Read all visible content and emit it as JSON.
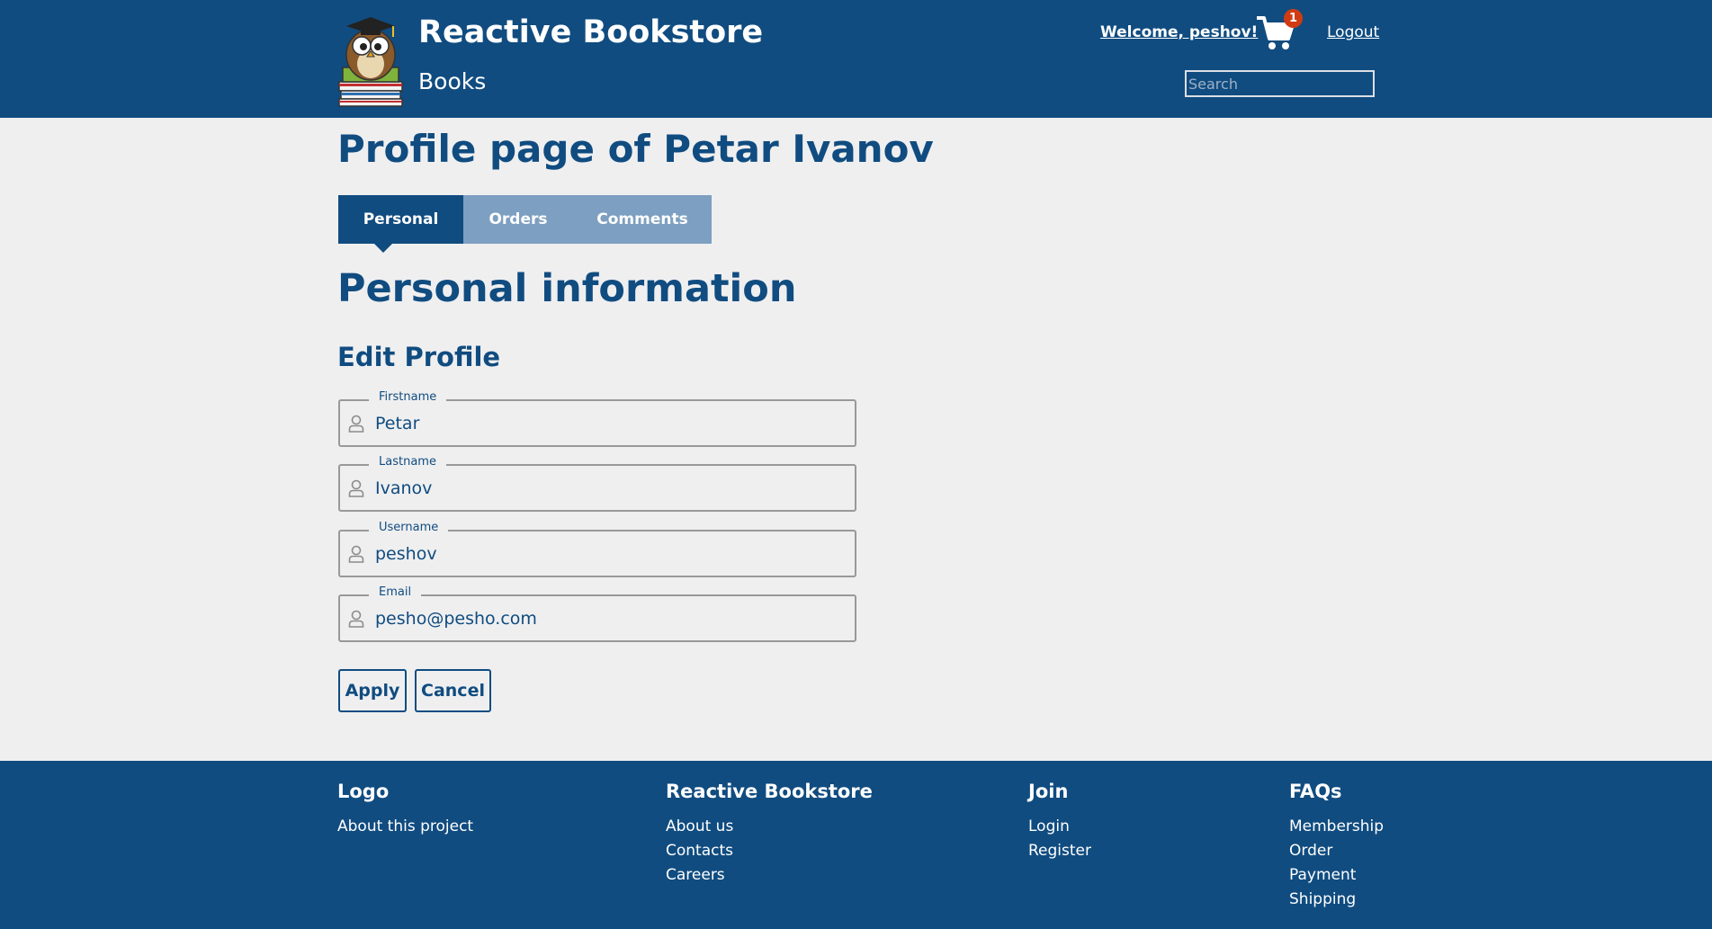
{
  "header": {
    "title": "Reactive Bookstore",
    "subtitle": "Books",
    "welcome": "Welcome, peshov!",
    "cart_count": "1",
    "logout": "Logout",
    "search_placeholder": "Search"
  },
  "page": {
    "title": "Profile page of Petar Ivanov",
    "tabs": [
      {
        "label": "Personal",
        "active": true
      },
      {
        "label": "Orders",
        "active": false
      },
      {
        "label": "Comments",
        "active": false
      }
    ],
    "section_title": "Personal information",
    "sub_title": "Edit Profile"
  },
  "form": {
    "fields": [
      {
        "label": "Firstname",
        "value": "Petar"
      },
      {
        "label": "Lastname",
        "value": "Ivanov"
      },
      {
        "label": "Username",
        "value": "peshov"
      },
      {
        "label": "Email",
        "value": "pesho@pesho.com"
      }
    ],
    "apply_label": "Apply",
    "cancel_label": "Cancel"
  },
  "footer": {
    "columns": [
      {
        "title": "Logo",
        "links": [
          "About this project"
        ]
      },
      {
        "title": "Reactive Bookstore",
        "links": [
          "About us",
          "Contacts",
          "Careers"
        ]
      },
      {
        "title": "Join",
        "links": [
          "Login",
          "Register"
        ]
      },
      {
        "title": "FAQs",
        "links": [
          "Membership",
          "Order",
          "Payment",
          "Shipping"
        ]
      }
    ]
  },
  "colors": {
    "primary": "#104c80",
    "tab_inactive": "#7d9fc1",
    "background": "#efeff0",
    "badge": "#d13b13"
  },
  "icons": {
    "cart": "shopping-cart-icon",
    "field": "user-icon",
    "logo": "owl-logo-icon"
  }
}
